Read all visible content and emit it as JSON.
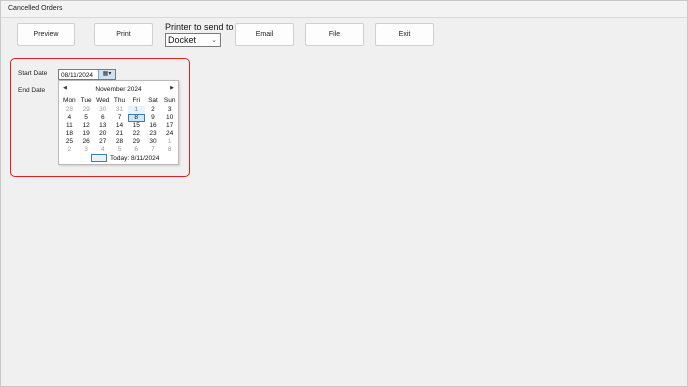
{
  "window": {
    "title": "Cancelled Orders"
  },
  "toolbar": {
    "preview_label": "Preview",
    "print_label": "Print",
    "email_label": "Email",
    "file_label": "File",
    "exit_label": "Exit"
  },
  "printer": {
    "label": "Printer to send to",
    "selected": "Docket"
  },
  "dates": {
    "start_label": "Start Date",
    "end_label": "End Date",
    "start_value": "08/11/2024"
  },
  "calendar": {
    "month_title": "November 2024",
    "weekdays": [
      "Mon",
      "Tue",
      "Wed",
      "Thu",
      "Fri",
      "Sat",
      "Sun"
    ],
    "weeks": [
      [
        "28",
        "29",
        "30",
        "31",
        "1",
        "2",
        "3"
      ],
      [
        "4",
        "5",
        "6",
        "7",
        "8",
        "9",
        "10"
      ],
      [
        "11",
        "12",
        "13",
        "14",
        "15",
        "16",
        "17"
      ],
      [
        "18",
        "19",
        "20",
        "21",
        "22",
        "23",
        "24"
      ],
      [
        "25",
        "26",
        "27",
        "28",
        "29",
        "30",
        "1"
      ],
      [
        "2",
        "3",
        "4",
        "5",
        "6",
        "7",
        "8"
      ]
    ],
    "today_label": "Today: 8/11/2024",
    "selected_day": "8"
  },
  "colors": {
    "highlight_border": "#e02020",
    "selection_blue": "#3c7fb1"
  }
}
